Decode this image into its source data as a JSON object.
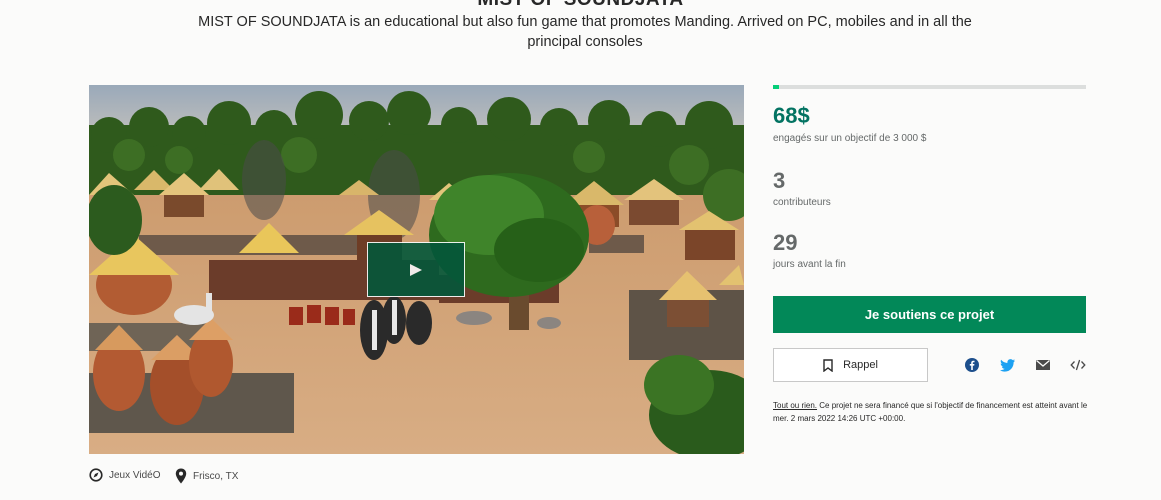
{
  "project": {
    "title": "MIST OF SOUNDJATA",
    "blurb": "MIST OF SOUNDJATA is an educational but also fun game that promotes Manding. Arrived on PC, mobiles and in all the principal consoles"
  },
  "meta": {
    "category": "Jeux VidéO",
    "location": "Frisco, TX"
  },
  "stats": {
    "progress_percent": 2,
    "pledged": "68$",
    "pledged_label": "engagés sur un objectif de 3 000 $",
    "backers": "3",
    "backers_label": "contributeurs",
    "days": "29",
    "days_label": "jours avant la fin"
  },
  "actions": {
    "back_label": "Je soutiens ce projet",
    "remind_label": "Rappel"
  },
  "share_icons": [
    "facebook-icon",
    "twitter-icon",
    "email-icon",
    "embed-icon"
  ],
  "fine_print": {
    "link": "Tout ou rien.",
    "text": " Ce projet ne sera financé que si l'objectif de financement est atteint avant le mer. 2 mars 2022 14:26 UTC +00:00."
  },
  "colors": {
    "accent": "#028858",
    "pledged": "#037362",
    "progress": "#05ce78"
  }
}
